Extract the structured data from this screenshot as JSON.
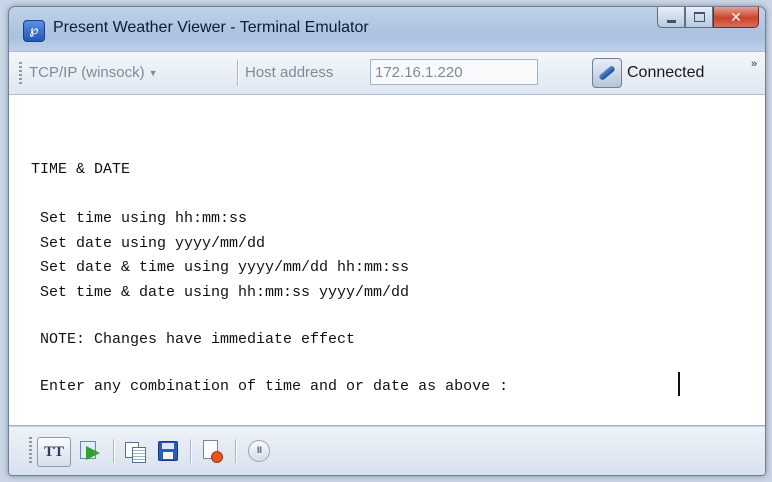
{
  "window": {
    "title": "Present Weather Viewer - Terminal Emulator",
    "icon": "app-logo-icon"
  },
  "toolbar": {
    "protocol": "TCP/IP (winsock)",
    "host_label": "Host address",
    "host_value": "172.16.1.220",
    "status": "Connected",
    "overflow": "»"
  },
  "terminal": {
    "lines": [
      "TIME & DATE",
      " Set time using hh:mm:ss",
      " Set date using yyyy/mm/dd",
      " Set date & time using yyyy/mm/dd hh:mm:ss",
      " Set time & date using hh:mm:ss yyyy/mm/dd",
      " NOTE: Changes have immediate effect",
      " Enter any combination of time and or date as above :"
    ]
  },
  "statusbar": {
    "tt_label": "TT",
    "pause_label": "II"
  },
  "colors": {
    "window_frame": "#a9c1df",
    "close_button": "#c7442b",
    "terminal_bg": "#ffffff"
  }
}
